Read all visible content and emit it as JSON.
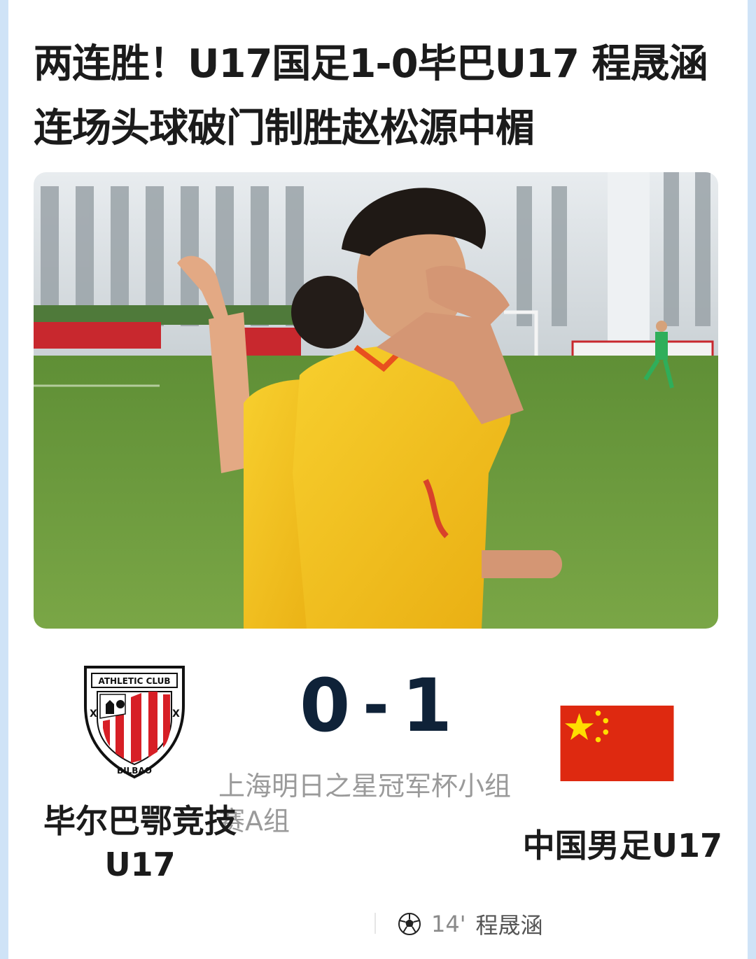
{
  "article": {
    "headline_line1": "两连胜！U17国足1-0毕巴U17 程晟涵",
    "headline_line2": "连场头球破门制胜赵松源中楣"
  },
  "match": {
    "home_team": "毕尔巴鄂竞技U17",
    "home_logo_text_top": "ATHLETIC CLUB",
    "home_logo_text_bottom": "BILBAO",
    "home_score": "0",
    "separator": "-",
    "away_score": "1",
    "away_team": "中国男足U17",
    "competition": "上海明日之星冠军杯小组赛A组",
    "goal": {
      "icon": "soccer-ball-icon",
      "minute": "14'",
      "player": "程晟涵"
    }
  },
  "colors": {
    "background": "#cfe3f7",
    "score": "#0f2238",
    "flag_red": "#de2910",
    "flag_yellow": "#ffde00",
    "jersey_yellow": "#f4c21b",
    "pitch_green": "#6c9a3c"
  }
}
